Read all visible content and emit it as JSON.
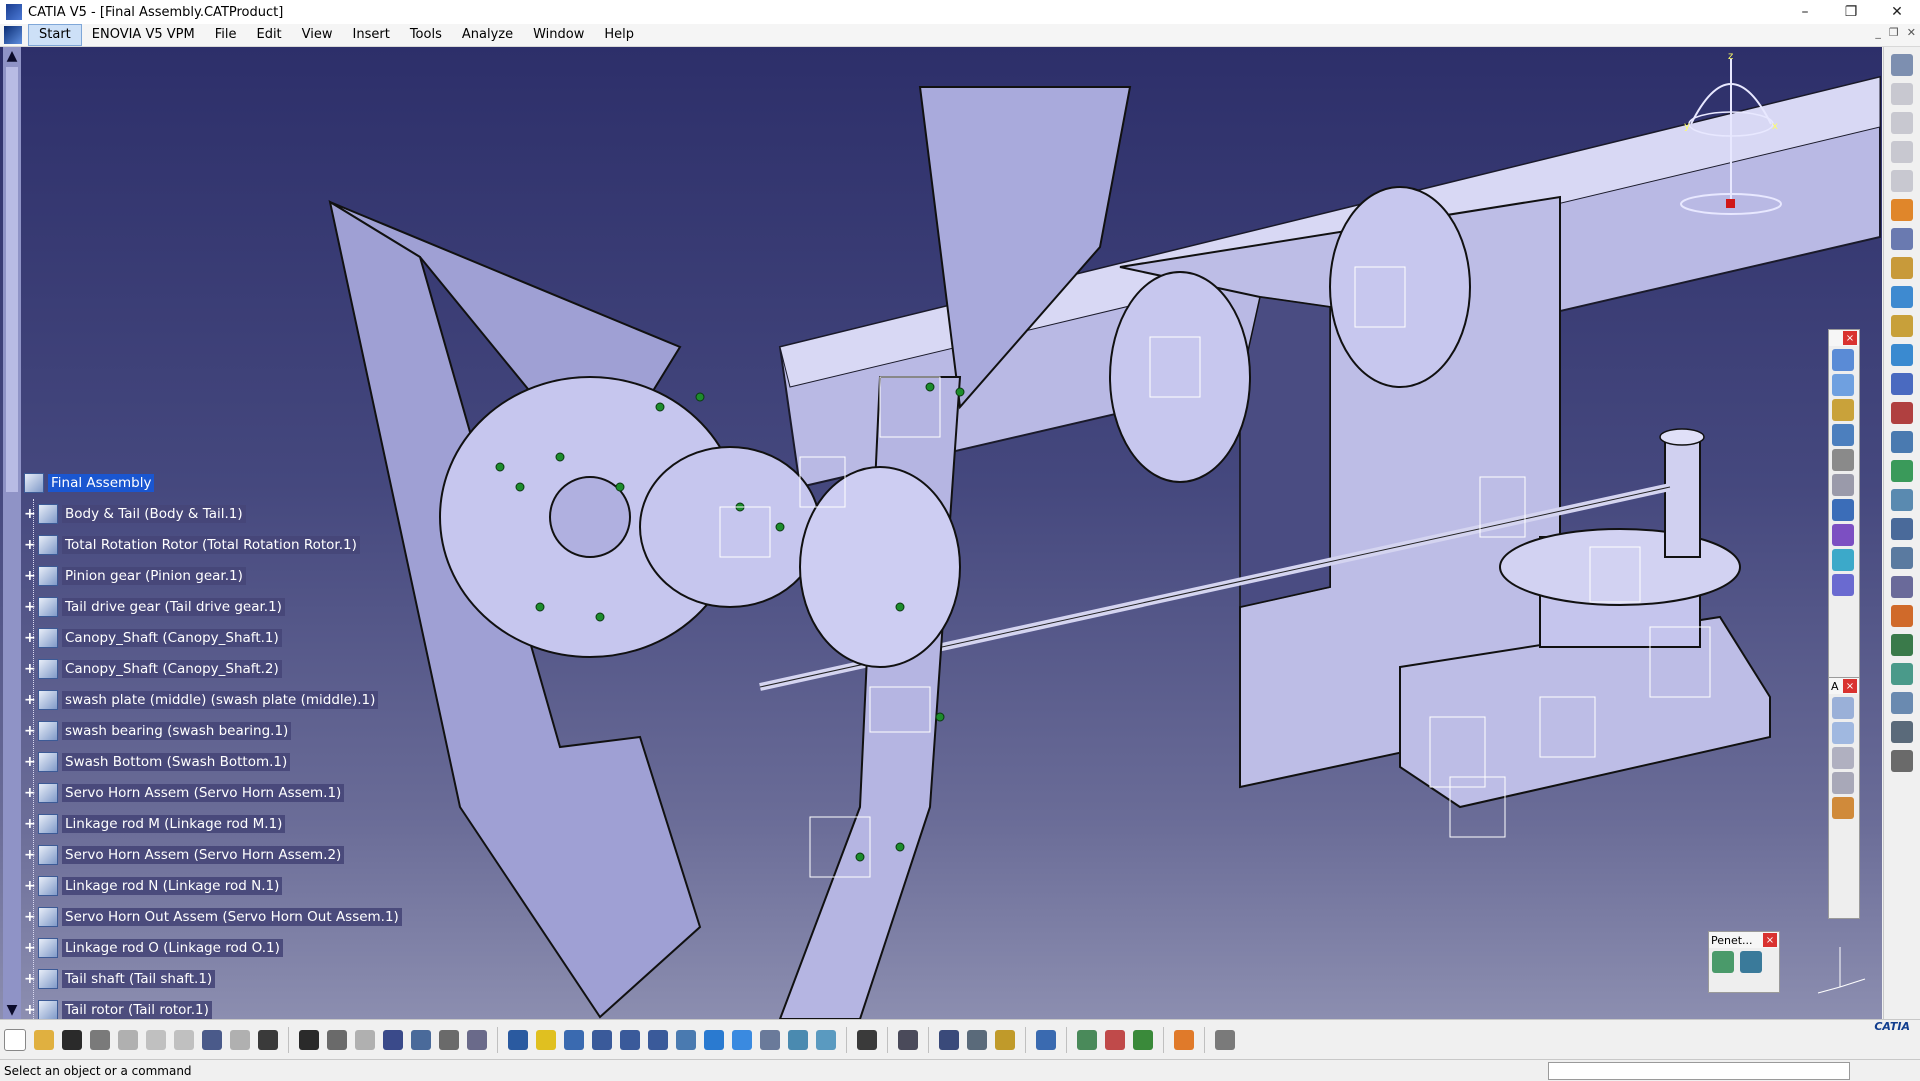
{
  "window": {
    "title": "CATIA V5 - [Final Assembly.CATProduct]",
    "controls": [
      "–",
      "❐",
      "✕"
    ]
  },
  "menu": {
    "items": [
      "Start",
      "ENOVIA V5 VPM",
      "File",
      "Edit",
      "View",
      "Insert",
      "Tools",
      "Analyze",
      "Window",
      "Help"
    ]
  },
  "tree": {
    "root": "Final Assembly",
    "children": [
      "Body & Tail (Body & Tail.1)",
      "Total Rotation Rotor (Total Rotation Rotor.1)",
      "Pinion gear (Pinion gear.1)",
      "Tail drive gear (Tail drive gear.1)",
      "Canopy_Shaft (Canopy_Shaft.1)",
      "Canopy_Shaft (Canopy_Shaft.2)",
      "swash plate (middle) (swash plate (middle).1)",
      "swash bearing (swash bearing.1)",
      "Swash Bottom (Swash Bottom.1)",
      "Servo Horn Assem (Servo Horn Assem.1)",
      "Linkage rod M (Linkage rod M.1)",
      "Servo Horn Assem (Servo Horn Assem.2)",
      "Linkage rod N (Linkage rod N.1)",
      "Servo Horn Out Assem (Servo Horn Out Assem.1)",
      "Linkage rod O (Linkage rod O.1)",
      "Tail shaft (Tail shaft.1)",
      "Tail rotor (Tail rotor.1)"
    ]
  },
  "floating_toolbars": {
    "penet_title": "Penet..."
  },
  "compass_labels": {
    "z": "z",
    "x": "x",
    "y": "y"
  },
  "status": {
    "message": "Select an object or a command"
  },
  "brand": "CATIA",
  "colors": {
    "viewport_top": "#2d2f6a",
    "viewport_bottom": "#8c8eb0",
    "part_fill": "#c9c9ec",
    "tree_highlight": "#1a56d0"
  }
}
